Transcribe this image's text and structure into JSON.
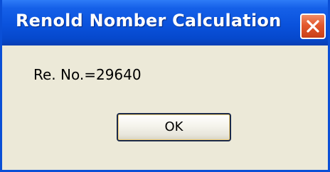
{
  "window": {
    "title": "Renold Nomber Calculation",
    "close_icon": "close-icon",
    "colors": {
      "titlebar": "#0a52dc",
      "body": "#ece9d8",
      "close_button": "#e3582d"
    }
  },
  "dialog": {
    "message": "Re. No.=29640",
    "ok_label": "OK"
  }
}
